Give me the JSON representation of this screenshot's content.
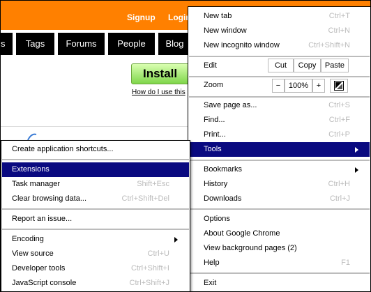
{
  "page": {
    "top_links": [
      "Signup",
      "Login"
    ],
    "tabs": [
      "s",
      "Tags",
      "Forums",
      "People",
      "Blog"
    ],
    "install_label": "Install",
    "how_link": "How do I use this"
  },
  "main_menu": {
    "new_tab": {
      "label": "New tab",
      "shortcut": "Ctrl+T"
    },
    "new_window": {
      "label": "New window",
      "shortcut": "Ctrl+N"
    },
    "new_incognito": {
      "label": "New incognito window",
      "shortcut": "Ctrl+Shift+N"
    },
    "edit": {
      "label": "Edit",
      "cut": "Cut",
      "copy": "Copy",
      "paste": "Paste"
    },
    "zoom": {
      "label": "Zoom",
      "minus": "−",
      "value": "100%",
      "plus": "+"
    },
    "save_page": {
      "label": "Save page as...",
      "shortcut": "Ctrl+S"
    },
    "find": {
      "label": "Find...",
      "shortcut": "Ctrl+F"
    },
    "print": {
      "label": "Print...",
      "shortcut": "Ctrl+P"
    },
    "tools": {
      "label": "Tools"
    },
    "bookmarks": {
      "label": "Bookmarks"
    },
    "history": {
      "label": "History",
      "shortcut": "Ctrl+H"
    },
    "downloads": {
      "label": "Downloads",
      "shortcut": "Ctrl+J"
    },
    "options": {
      "label": "Options"
    },
    "about": {
      "label": "About Google Chrome"
    },
    "background_pages": {
      "label": "View background pages (2)"
    },
    "help": {
      "label": "Help",
      "shortcut": "F1"
    },
    "exit": {
      "label": "Exit"
    }
  },
  "tools_menu": {
    "create_shortcuts": {
      "label": "Create application shortcuts..."
    },
    "extensions": {
      "label": "Extensions"
    },
    "task_manager": {
      "label": "Task manager",
      "shortcut": "Shift+Esc"
    },
    "clear_data": {
      "label": "Clear browsing data...",
      "shortcut": "Ctrl+Shift+Del"
    },
    "report_issue": {
      "label": "Report an issue..."
    },
    "encoding": {
      "label": "Encoding"
    },
    "view_source": {
      "label": "View source",
      "shortcut": "Ctrl+U"
    },
    "dev_tools": {
      "label": "Developer tools",
      "shortcut": "Ctrl+Shift+I"
    },
    "js_console": {
      "label": "JavaScript console",
      "shortcut": "Ctrl+Shift+J"
    }
  },
  "colors": {
    "orange_bar": "#ff8000",
    "highlight": "#0a0a80"
  }
}
